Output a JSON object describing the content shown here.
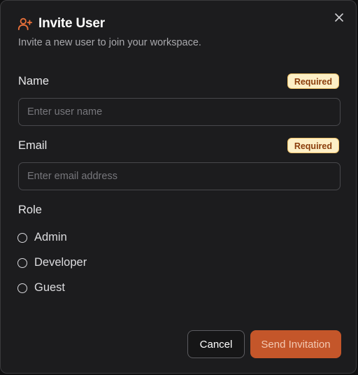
{
  "dialog": {
    "title": "Invite User",
    "subtitle": "Invite a new user to join your workspace.",
    "title_icon": "user-plus-icon",
    "close_icon": "close-icon"
  },
  "fields": {
    "name": {
      "label": "Name",
      "badge": "Required",
      "placeholder": "Enter user name",
      "value": ""
    },
    "email": {
      "label": "Email",
      "badge": "Required",
      "placeholder": "Enter email address",
      "value": ""
    }
  },
  "role": {
    "label": "Role",
    "options": [
      {
        "label": "Admin",
        "selected": false
      },
      {
        "label": "Developer",
        "selected": false
      },
      {
        "label": "Guest",
        "selected": false
      }
    ]
  },
  "actions": {
    "cancel_label": "Cancel",
    "send_label": "Send Invitation"
  },
  "colors": {
    "accent": "#c4562a",
    "icon_accent": "#e8703a",
    "badge_bg": "#fdefc6",
    "badge_text": "#8a3d0b",
    "background": "#1c1c1e"
  }
}
